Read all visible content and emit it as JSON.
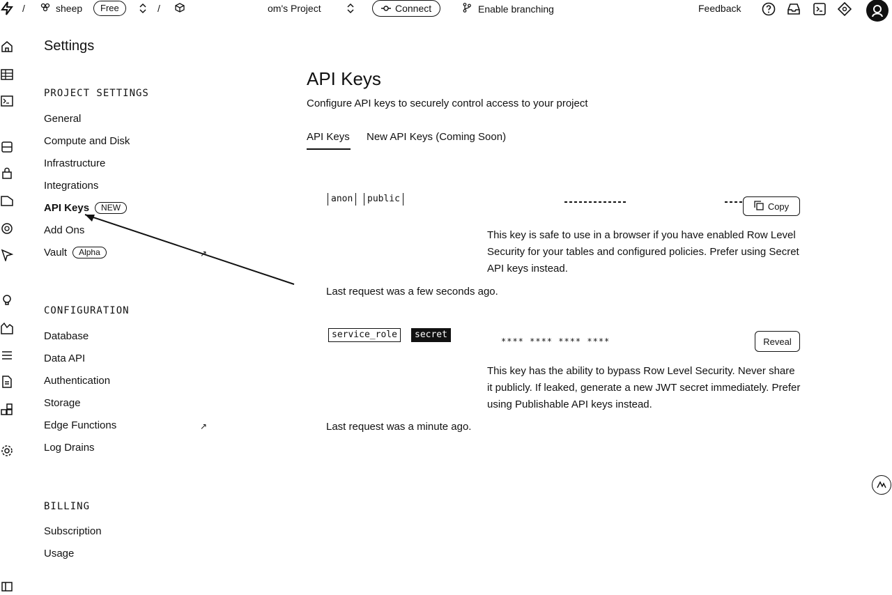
{
  "topbar": {
    "org_name": "sheep",
    "plan_badge": "Free",
    "project_name": "om's Project",
    "connect_label": "Connect",
    "branching_label": "Enable branching",
    "feedback_label": "Feedback"
  },
  "sidebar": {
    "title": "Settings",
    "project_settings": {
      "heading": "PROJECT SETTINGS",
      "items": [
        {
          "label": "General"
        },
        {
          "label": "Compute and Disk"
        },
        {
          "label": "Infrastructure"
        },
        {
          "label": "Integrations"
        },
        {
          "label": "API Keys",
          "badge": "NEW"
        },
        {
          "label": "Add Ons"
        },
        {
          "label": "Vault",
          "badge": "Alpha"
        }
      ]
    },
    "configuration": {
      "heading": "CONFIGURATION",
      "items": [
        {
          "label": "Database"
        },
        {
          "label": "Data API"
        },
        {
          "label": "Authentication"
        },
        {
          "label": "Storage"
        },
        {
          "label": "Edge Functions"
        },
        {
          "label": "Log Drains"
        }
      ]
    },
    "billing": {
      "heading": "BILLING",
      "items": [
        {
          "label": "Subscription"
        },
        {
          "label": "Usage"
        }
      ]
    }
  },
  "main": {
    "title": "API Keys",
    "description": "Configure API keys to securely control access to your project",
    "tabs": [
      {
        "label": "API Keys"
      },
      {
        "label": "New API Keys (Coming Soon)"
      }
    ],
    "keys": [
      {
        "tags": [
          "anon",
          "public"
        ],
        "button_label": "Copy",
        "help": "This key is safe to use in a browser if you have enabled Row Level Security for your tables and configured policies. Prefer using Secret API keys instead.",
        "last_request": "Last request was a few seconds ago."
      },
      {
        "tags": [
          "service_role",
          "secret"
        ],
        "masked_value": "**** **** **** ****",
        "button_label": "Reveal",
        "help": "This key has the ability to bypass Row Level Security. Never share it publicly. If leaked, generate a new JWT secret immediately. Prefer using Publishable API keys instead.",
        "last_request": "Last request was a minute ago."
      }
    ]
  },
  "colors": {
    "text": "#111111",
    "background": "#ffffff"
  }
}
